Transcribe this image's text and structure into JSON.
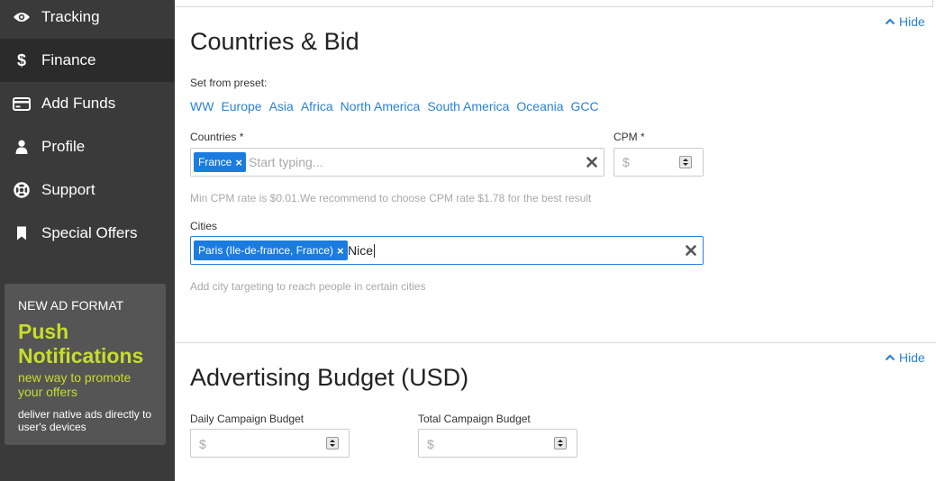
{
  "sidebar": {
    "items": [
      {
        "label": "Tracking",
        "icon": "eye-icon"
      },
      {
        "label": "Finance",
        "icon": "dollar-icon",
        "active": true
      },
      {
        "label": "Add Funds",
        "icon": "credit-card-icon"
      },
      {
        "label": "Profile",
        "icon": "user-icon"
      },
      {
        "label": "Support",
        "icon": "lifebuoy-icon"
      },
      {
        "label": "Special Offers",
        "icon": "bookmark-icon"
      }
    ],
    "promo": {
      "tag": "NEW AD FORMAT",
      "title": "Push Notifications",
      "subtitle": "new way to promote your offers",
      "description": "deliver native ads directly to user's devices"
    }
  },
  "countries_section": {
    "title": "Countries & Bid",
    "hide_label": "Hide",
    "preset_label": "Set from preset:",
    "presets": [
      "WW",
      "Europe",
      "Asia",
      "Africa",
      "North America",
      "South America",
      "Oceania",
      "GCC"
    ],
    "countries_label": "Countries *",
    "countries_tags": [
      "France"
    ],
    "countries_placeholder": "Start typing...",
    "cpm_label": "CPM *",
    "cpm_placeholder": "$",
    "cpm_hint": "Min CPM rate is $0.01.We recommend to choose CPM rate $1.78 for the best result",
    "cities_label": "Cities",
    "cities_tags": [
      "Paris (Ile-de-france, France)"
    ],
    "cities_input_value": "Nice",
    "cities_hint": "Add city targeting to reach people in certain cities"
  },
  "budget_section": {
    "title": "Advertising Budget (USD)",
    "hide_label": "Hide",
    "daily_label": "Daily Campaign Budget",
    "daily_placeholder": "$",
    "total_label": "Total Campaign Budget",
    "total_placeholder": "$"
  },
  "colors": {
    "sidebar_bg": "#3a3a3a",
    "sidebar_active_bg": "#2b2b2b",
    "promo_accent": "#c7dd2c",
    "link_blue": "#2a82d6",
    "tag_blue": "#1b7ce0"
  }
}
